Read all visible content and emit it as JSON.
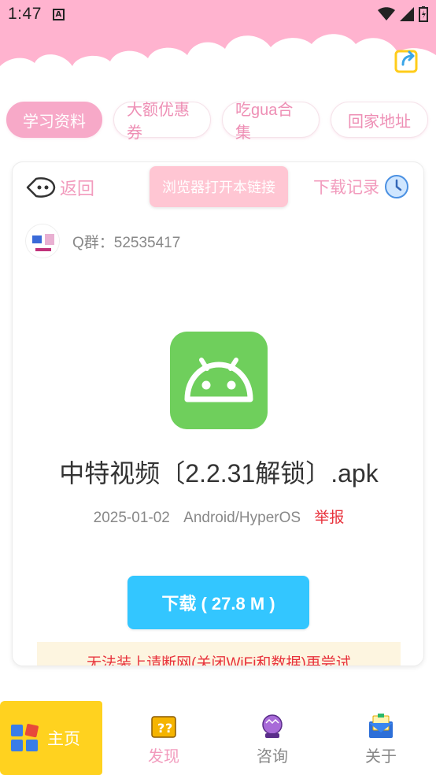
{
  "status": {
    "time": "1:47",
    "notif": "A"
  },
  "tabs": [
    {
      "label": "学习资料",
      "active": true
    },
    {
      "label": "大额优惠券",
      "active": false
    },
    {
      "label": "吃gua合集",
      "active": false
    },
    {
      "label": "回家地址",
      "active": false
    }
  ],
  "card": {
    "back_label": "返回",
    "browser_button": "浏览器打开本链接",
    "history_label": "下载记录",
    "qq_group": "Q群：52535417",
    "file_name": "中特视频〔2.2.31解锁〕.apk",
    "date": "2025-01-02",
    "platform": "Android/HyperOS",
    "report": "举报",
    "download_button": "下载 ( 27.8 M )",
    "warning": "无法装上请断网(关闭WiFi和数据)再尝试"
  },
  "nav": {
    "home": "主页",
    "discover": "发现",
    "consult": "咨询",
    "about": "关于"
  },
  "colors": {
    "pink": "#f7a9c8",
    "pink_text": "#f29bbd",
    "download_blue": "#33c6ff",
    "app_green": "#6fcf5c",
    "home_yellow": "#ffd21f",
    "report_red": "#e8323c"
  }
}
